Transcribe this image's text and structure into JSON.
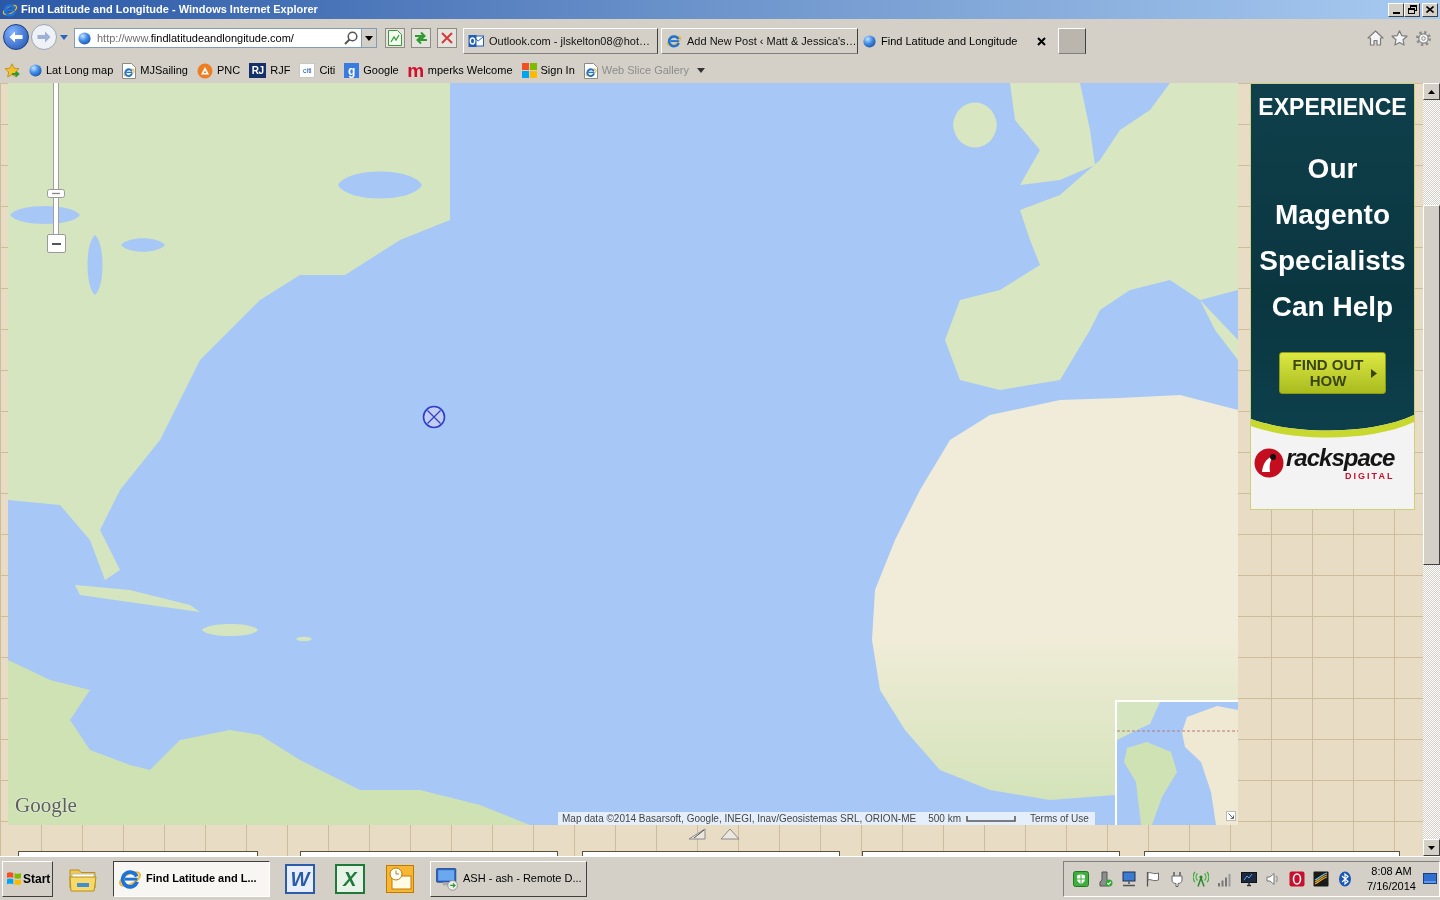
{
  "window": {
    "title": "Find Latitude and Longitude - Windows Internet Explorer"
  },
  "address_bar": {
    "scheme": "http://www.",
    "host": "findlatitudeandlongitude.com/"
  },
  "tabs": [
    {
      "title": "Outlook.com - jlskelton08@hot…",
      "selected": false
    },
    {
      "title": "Add New Post ‹ Matt & Jessica's…",
      "selected": false
    },
    {
      "title": "Find Latitude and Longitude",
      "selected": true
    }
  ],
  "favorites": [
    {
      "label": "Lat Long map",
      "disabled": false,
      "menu": false
    },
    {
      "label": "MJSailing",
      "disabled": false,
      "menu": false
    },
    {
      "label": "PNC",
      "disabled": false,
      "menu": false
    },
    {
      "label": "RJF",
      "logo": "RJ",
      "disabled": false,
      "menu": false
    },
    {
      "label": "Citi",
      "logo": "citi",
      "disabled": false,
      "menu": false
    },
    {
      "label": "Google",
      "logo": "g",
      "disabled": false,
      "menu": false
    },
    {
      "label": "mperks Welcome",
      "logo": "m",
      "disabled": false,
      "menu": false
    },
    {
      "label": "Sign In",
      "disabled": false,
      "menu": false
    },
    {
      "label": "Web Slice Gallery",
      "disabled": true,
      "menu": true
    }
  ],
  "map": {
    "zoom_slider": {
      "level": 0.26
    },
    "logo": "Google",
    "attribution": "Map data ©2014 Basarsoft, Google, INEGI, Inav/Geosistemas SRL, ORION-ME",
    "scale": "500 km",
    "terms": "Terms of Use"
  },
  "ad": {
    "kicker": "EXPERIENCE",
    "headline": "Our Magento Specialists Can Help",
    "button": "FIND OUT HOW",
    "brand": "rackspace",
    "brand_sub": "DIGITAL"
  },
  "taskbar": {
    "start": "Start",
    "items": [
      {
        "kind": "launcher"
      },
      {
        "kind": "task",
        "label": "Find Latitude and L...",
        "selected": true
      },
      {
        "kind": "launcher",
        "logo": "W"
      },
      {
        "kind": "launcher",
        "logo": "X"
      },
      {
        "kind": "launcher"
      },
      {
        "kind": "task",
        "label": "ASH - ash - Remote D...",
        "selected": false
      }
    ],
    "clock": {
      "time": "8:08 AM",
      "date": "7/16/2014"
    }
  }
}
